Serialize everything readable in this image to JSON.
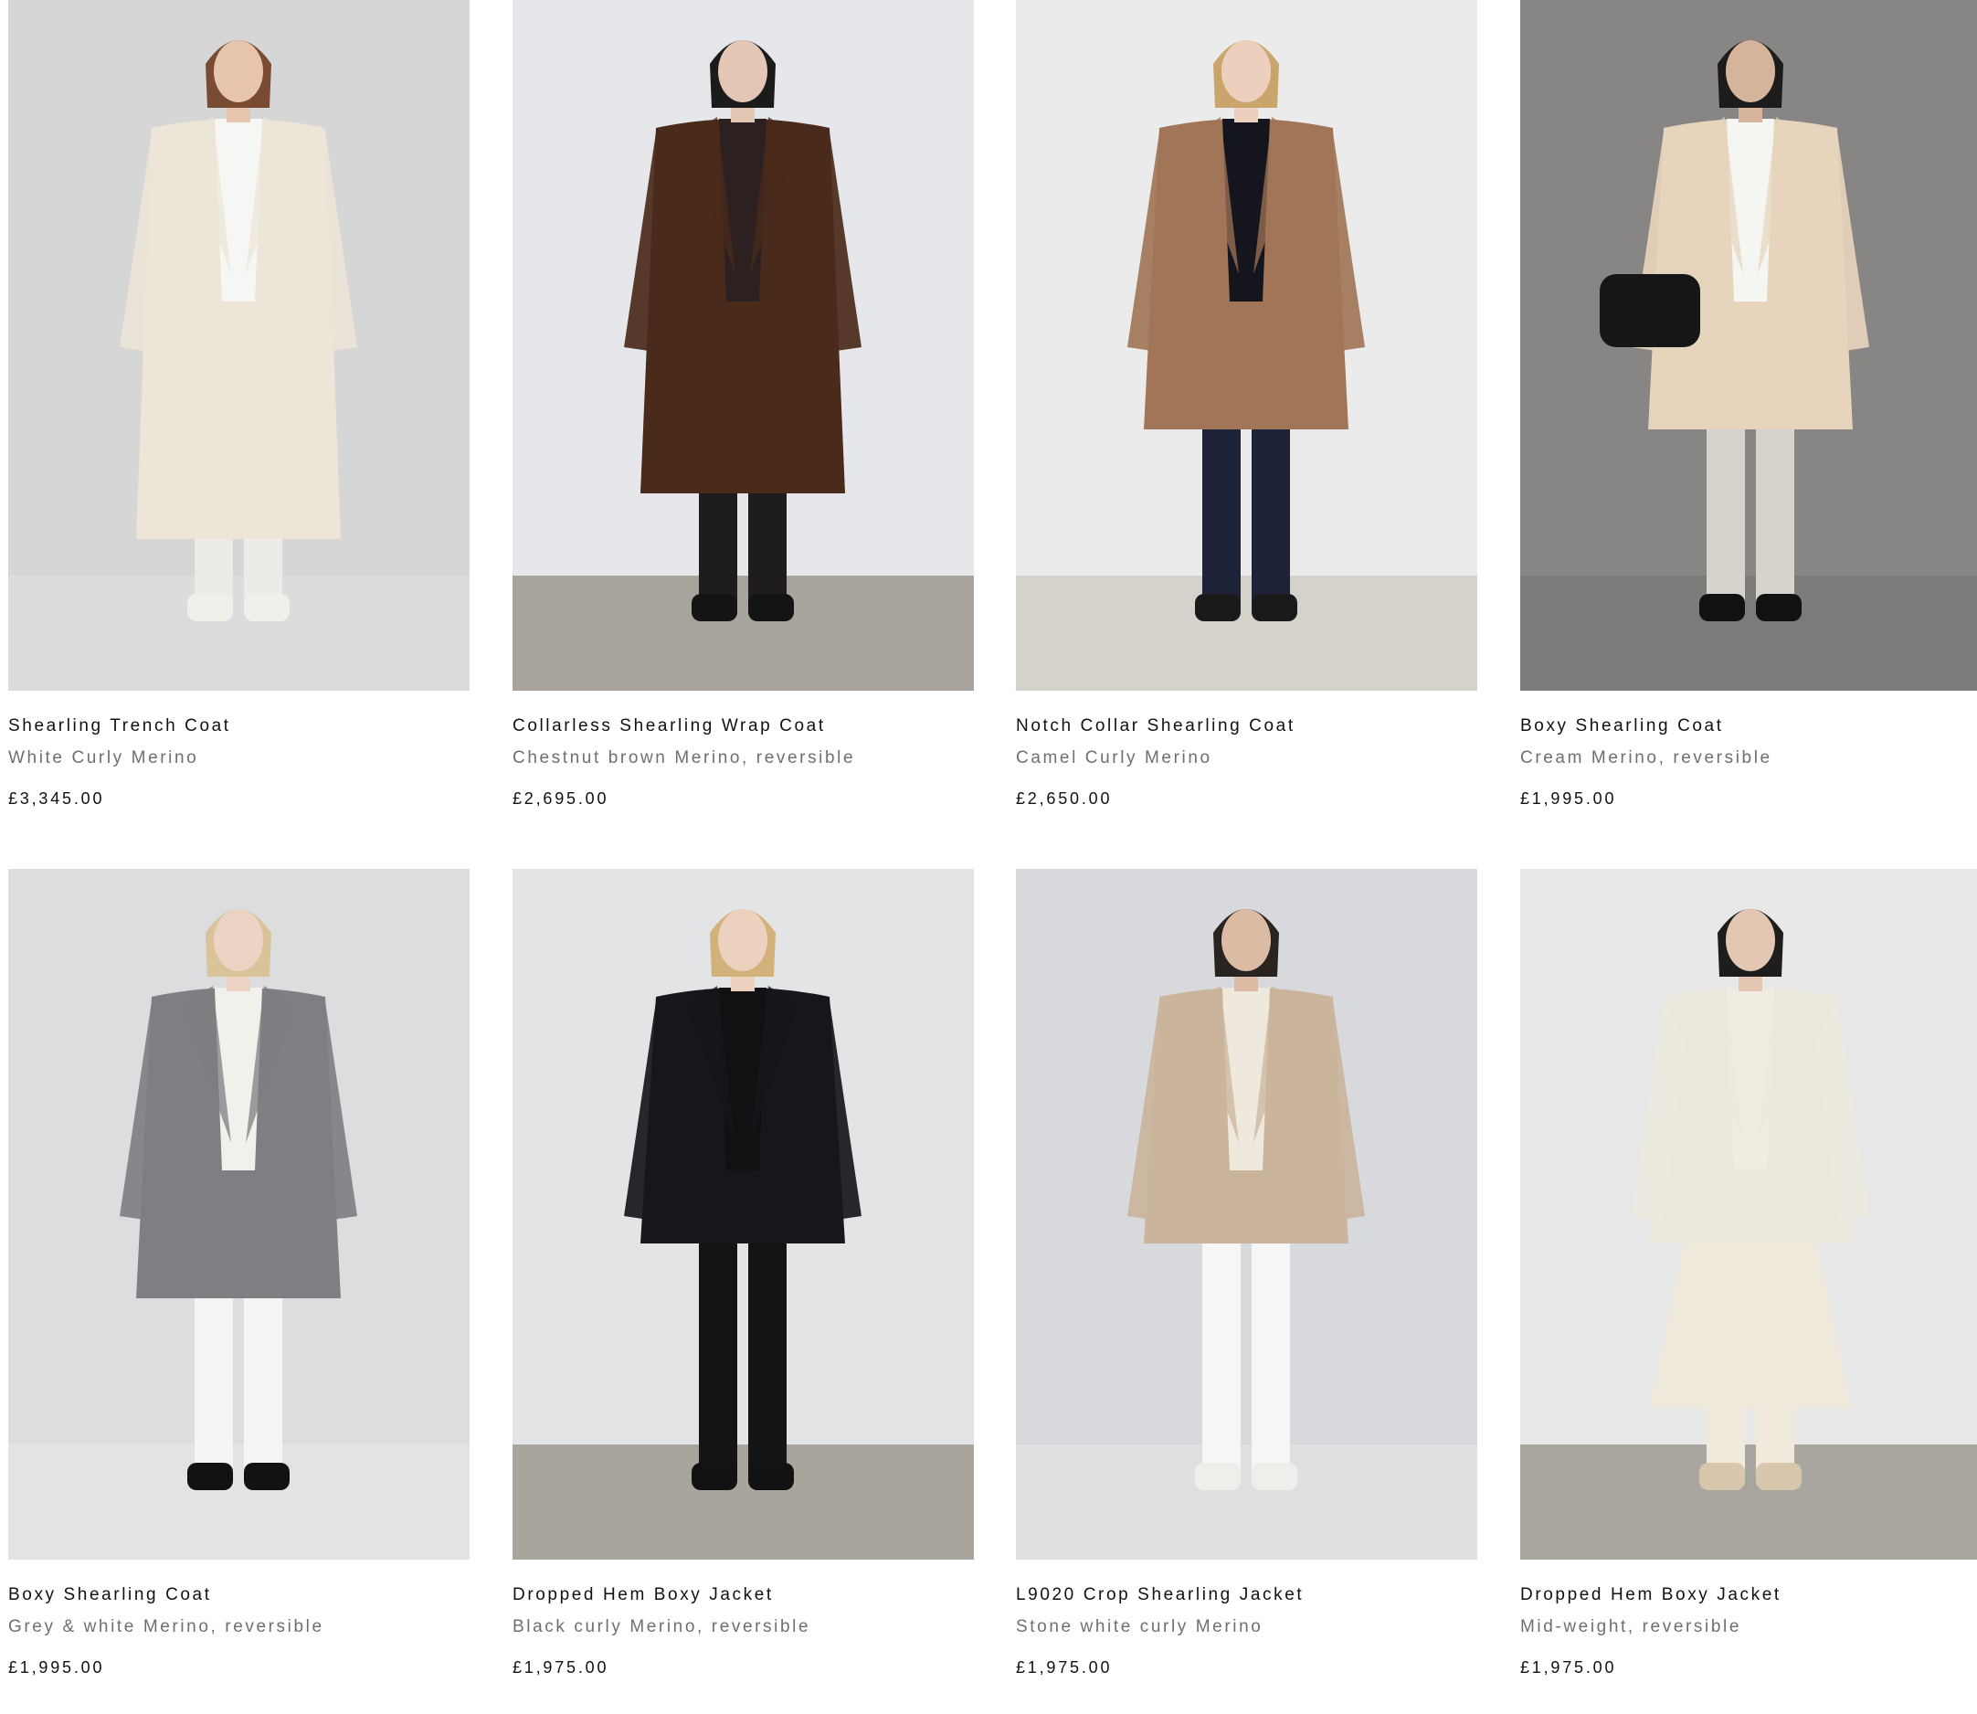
{
  "products": [
    {
      "name": "Shearling Trench Coat",
      "variant": "White Curly Merino",
      "price": "£3,345.00",
      "image": {
        "backdrop": "#d6d6d6",
        "floor": "#dcdcdc",
        "coat": "#ece5d8",
        "inner": "#f6f6f4",
        "legs": "#ecebe6",
        "shoes": "#f1efea",
        "hair": "#7a4b33",
        "skin": "#e6c4ae",
        "coat_length": "long",
        "accessory": "none"
      }
    },
    {
      "name": "Collarless Shearling Wrap Coat",
      "variant": "Chestnut brown Merino, reversible",
      "price": "£2,695.00",
      "image": {
        "backdrop": "#e6e7ea",
        "floor": "#a8a49d",
        "coat": "#4a2a1a",
        "inner": "#2c2021",
        "legs": "#1e1c1d",
        "shoes": "#141414",
        "hair": "#1b1b1b",
        "skin": "#e3c6b3",
        "coat_length": "knee",
        "accessory": "none"
      }
    },
    {
      "name": "Notch Collar Shearling Coat",
      "variant": "Camel Curly Merino",
      "price": "£2,650.00",
      "image": {
        "backdrop": "#ebebeb",
        "floor": "#d5d2cc",
        "coat": "#a17557",
        "inner": "#15151d",
        "legs": "#1e2238",
        "shoes": "#1a1a1a",
        "hair": "#c9a56c",
        "skin": "#ecd0bd",
        "coat_length": "hip",
        "accessory": "none"
      }
    },
    {
      "name": "Boxy Shearling Coat",
      "variant": "Cream Merino, reversible",
      "price": "£1,995.00",
      "image": {
        "backdrop": "#878685",
        "floor": "#7c7b79",
        "coat": "#e6d4bd",
        "inner": "#f5f5f2",
        "legs": "#d6d3cd",
        "shoes": "#111111",
        "hair": "#1c1c1c",
        "skin": "#d6b49b",
        "coat_length": "hip",
        "accessory": "bag"
      }
    },
    {
      "name": "Boxy Shearling Coat",
      "variant": "Grey & white Merino, reversible",
      "price": "£1,995.00",
      "image": {
        "backdrop": "#dcdddf",
        "floor": "#e2e3e5",
        "coat": "#7f7e82",
        "inner": "#f2f0ea",
        "legs": "#f4f4f4",
        "shoes": "#121212",
        "hair": "#d9c49a",
        "skin": "#ecd3c4",
        "coat_length": "hip",
        "accessory": "none"
      }
    },
    {
      "name": "Dropped Hem Boxy Jacket",
      "variant": "Black curly Merino, reversible",
      "price": "£1,975.00",
      "image": {
        "backdrop": "#e3e4e6",
        "floor": "#aaa59c",
        "coat": "#17171b",
        "inner": "#111114",
        "legs": "#141416",
        "shoes": "#121212",
        "hair": "#d2b27a",
        "skin": "#ecd1bf",
        "coat_length": "short",
        "accessory": "none"
      }
    },
    {
      "name": "L9020 Crop Shearling Jacket",
      "variant": "Stone white curly Merino",
      "price": "£1,975.00",
      "image": {
        "backdrop": "#d8d9dc",
        "floor": "#dfe0e2",
        "coat": "#cbb49c",
        "inner": "#efe9dd",
        "legs": "#f6f6f6",
        "shoes": "#f0eeea",
        "hair": "#2a2420",
        "skin": "#dcbba5",
        "coat_length": "short",
        "accessory": "none"
      }
    },
    {
      "name": "Dropped Hem Boxy Jacket",
      "variant": "Mid-weight, reversible",
      "price": "£1,975.00",
      "image": {
        "backdrop": "#e8e8e8",
        "floor": "#a9a6a0",
        "coat": "#ece8de",
        "inner": "#f0ece2",
        "legs": "#efeadc",
        "shoes": "#d8c6ad",
        "hair": "#1d1d1d",
        "skin": "#e4c7b2",
        "coat_length": "short",
        "accessory": "skirt"
      }
    }
  ]
}
